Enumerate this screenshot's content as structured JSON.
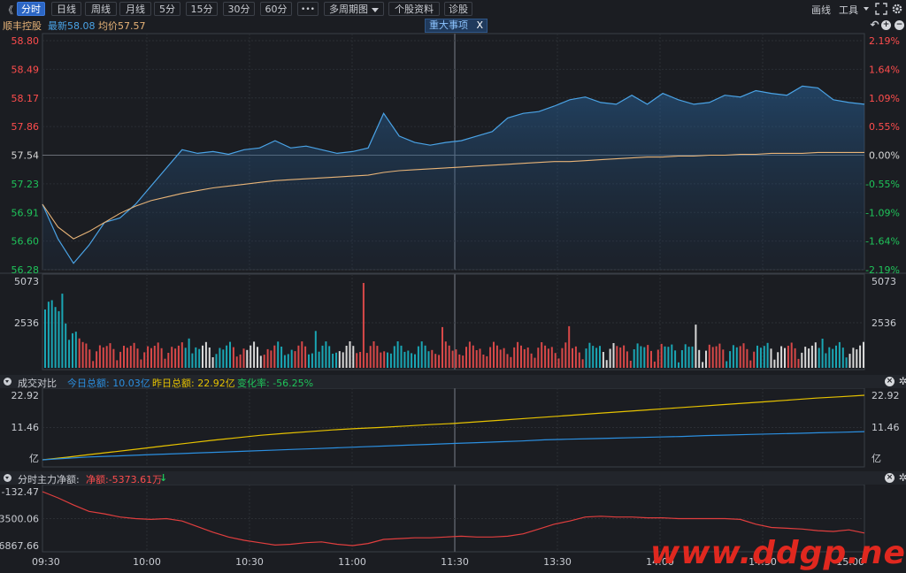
{
  "toolbar": {
    "back": "《",
    "tabs": [
      "分时",
      "日线",
      "周线",
      "月线",
      "5分",
      "15分",
      "30分",
      "60分"
    ],
    "more": "•••",
    "multi_period": "多周期图",
    "stock_info": "个股资料",
    "diagnose": "诊股",
    "draw": "画线",
    "tools": "工具",
    "expand_icon": "expand-icon",
    "settings_icon": "settings-icon"
  },
  "info": {
    "name": "顺丰控股",
    "latest": "最新58.08",
    "avg": "均价57.57",
    "event": "重大事项",
    "close_x": "X"
  },
  "colors": {
    "up": "#ff4d4d",
    "down": "#1fc45a",
    "price": "#4aa3e6",
    "avg": "#e8b478",
    "volume_up": "#d84848",
    "volume_down": "#1aa6b4",
    "volume_flat": "#d8d8d8",
    "today_amt": "#2b8fe0",
    "yday_amt": "#e6c200",
    "net_flow": "#e03e3e",
    "watermark": "#e0281f"
  },
  "panel_volume": {
    "labels": [
      "5073",
      "2536"
    ]
  },
  "panel_amount": {
    "title": "成交对比",
    "today": "今日总额: 10.03亿",
    "yesterday": "昨日总额: 22.92亿",
    "change": "变化率: -56.25%",
    "labels": [
      "22.92",
      "11.46",
      "亿"
    ]
  },
  "panel_flow": {
    "title": "分时主力净额:",
    "net": "净额:-5373.61万",
    "labels": [
      "-132.47",
      "-3500.06",
      "-6867.66"
    ]
  },
  "x_labels": [
    "09:30",
    "10:00",
    "10:30",
    "11:00",
    "11:30",
    "13:30",
    "14:00",
    "14:30",
    "15:00"
  ],
  "watermark": "www.ddgp.net",
  "chart_data": {
    "type": "line",
    "title": "",
    "x": [
      "09:30",
      "10:00",
      "10:30",
      "11:00",
      "11:30",
      "13:30",
      "14:00",
      "14:30",
      "15:00"
    ],
    "ylim": [
      56.28,
      58.8
    ],
    "y_ticks_left": [
      "58.80",
      "58.49",
      "58.17",
      "57.86",
      "57.54",
      "57.23",
      "56.91",
      "56.60",
      "56.28"
    ],
    "y_ticks_right": [
      "2.19%",
      "1.64%",
      "1.09%",
      "0.55%",
      "0.00%",
      "-0.55%",
      "-1.09%",
      "-1.64%",
      "-2.19%"
    ],
    "prev_close": 57.54,
    "series": [
      {
        "values": [
          57.0,
          56.62,
          56.35,
          56.55,
          56.8,
          56.85,
          57.0,
          57.2,
          57.4,
          57.6,
          57.56,
          57.58,
          57.55,
          57.6,
          57.62,
          57.7,
          57.62,
          57.64,
          57.6,
          57.56,
          57.58,
          57.62,
          58.0,
          57.75,
          57.68,
          57.65,
          57.68,
          57.7,
          57.75,
          57.8,
          57.95,
          58.0,
          58.02,
          58.08,
          58.15,
          58.18,
          58.12,
          58.1,
          58.2,
          58.1,
          58.22,
          58.15,
          58.1,
          58.12,
          58.2,
          58.18,
          58.25,
          58.22,
          58.2,
          58.3,
          58.28,
          58.15,
          58.12,
          58.1
        ]
      },
      {
        "values": [
          57.0,
          56.75,
          56.62,
          56.7,
          56.8,
          56.9,
          56.98,
          57.04,
          57.08,
          57.12,
          57.15,
          57.18,
          57.2,
          57.22,
          57.24,
          57.26,
          57.27,
          57.28,
          57.29,
          57.3,
          57.31,
          57.32,
          57.35,
          57.37,
          57.38,
          57.39,
          57.4,
          57.41,
          57.42,
          57.43,
          57.44,
          57.45,
          57.46,
          57.47,
          57.47,
          57.48,
          57.49,
          57.5,
          57.51,
          57.52,
          57.52,
          57.53,
          57.53,
          57.54,
          57.54,
          57.55,
          57.55,
          57.56,
          57.56,
          57.56,
          57.57,
          57.57,
          57.57,
          57.57
        ]
      }
    ],
    "amount_today": [
      0,
      0.5,
      1.0,
      1.3,
      1.6,
      1.9,
      2.2,
      2.5,
      2.8,
      3.1,
      3.4,
      3.7,
      4.0,
      4.3,
      4.6,
      4.9,
      5.2,
      5.5,
      5.8,
      6.1,
      6.4,
      6.7,
      7.1,
      7.3,
      7.5,
      7.7,
      7.9,
      8.1,
      8.3,
      8.6,
      8.8,
      9.0,
      9.2,
      9.4,
      9.6,
      9.8,
      10.03
    ],
    "amount_yesterday": [
      0,
      0.9,
      1.9,
      2.9,
      3.9,
      4.9,
      5.9,
      6.9,
      7.8,
      8.7,
      9.4,
      10.0,
      10.6,
      11.1,
      11.5,
      12.0,
      12.5,
      12.9,
      13.5,
      14.1,
      14.7,
      15.3,
      15.9,
      16.5,
      17.1,
      17.7,
      18.3,
      18.9,
      19.5,
      20.1,
      20.7,
      21.3,
      21.9,
      22.4,
      22.92
    ],
    "net_flow": [
      -132,
      -900,
      -1800,
      -2600,
      -2900,
      -3300,
      -3500,
      -3600,
      -3500,
      -3800,
      -4500,
      -5200,
      -5800,
      -6200,
      -6500,
      -6800,
      -6700,
      -6500,
      -6400,
      -6700,
      -6867,
      -6600,
      -6100,
      -6000,
      -5900,
      -5900,
      -5800,
      -5700,
      -5800,
      -5800,
      -5700,
      -5400,
      -4800,
      -4200,
      -3800,
      -3300,
      -3200,
      -3300,
      -3300,
      -3400,
      -3400,
      -3500,
      -3500,
      -3500,
      -3500,
      -3600,
      -4200,
      -4600,
      -4700,
      -4800,
      -5000,
      -5100,
      -4900,
      -5300
    ]
  }
}
